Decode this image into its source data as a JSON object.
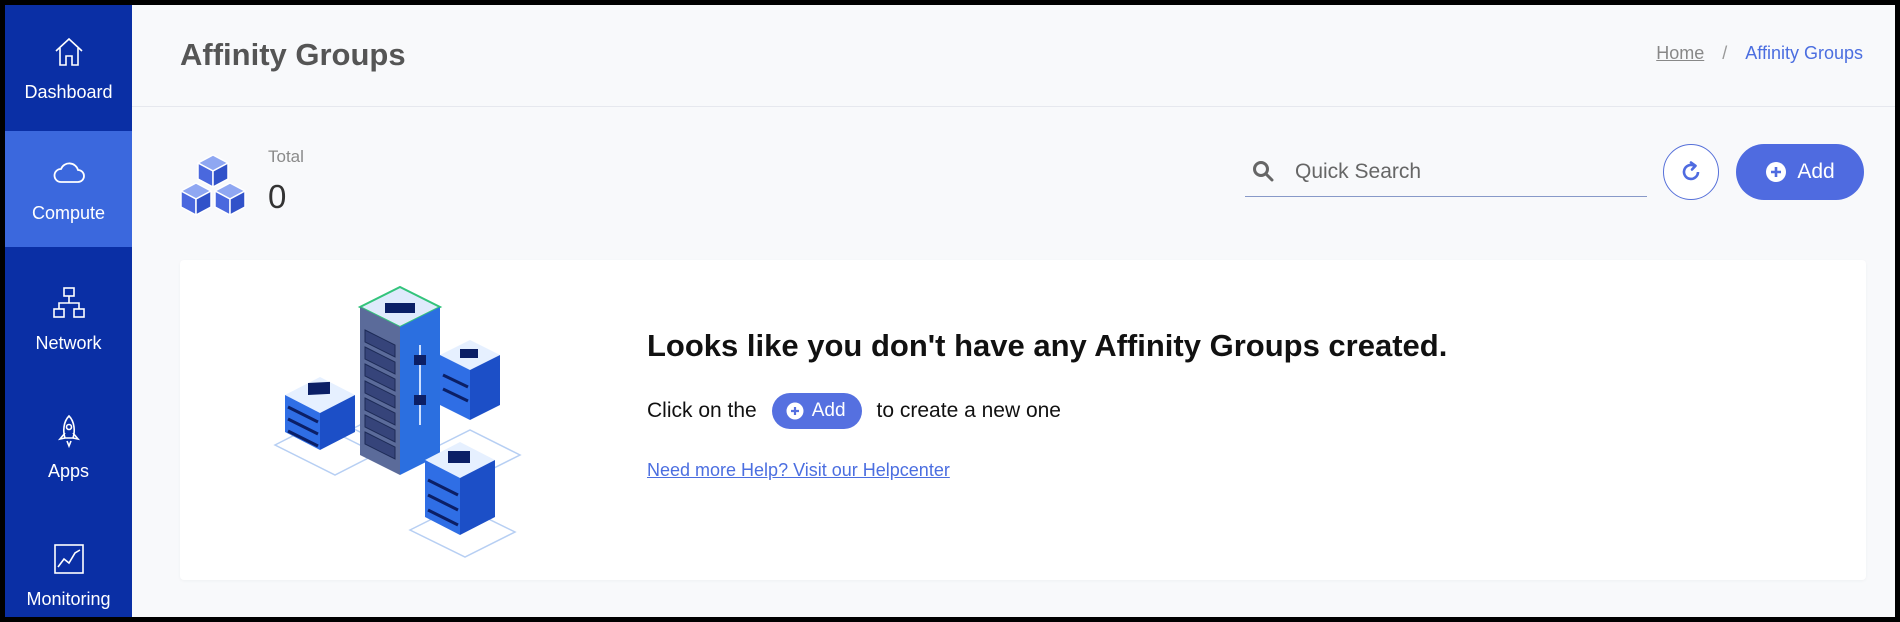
{
  "sidebar": {
    "items": [
      {
        "label": "Dashboard",
        "icon": "home-icon",
        "active": false
      },
      {
        "label": "Compute",
        "icon": "cloud-icon",
        "active": true
      },
      {
        "label": "Network",
        "icon": "network-icon",
        "active": false
      },
      {
        "label": "Apps",
        "icon": "rocket-icon",
        "active": false
      },
      {
        "label": "Monitoring",
        "icon": "chart-icon",
        "active": false
      }
    ]
  },
  "header": {
    "title": "Affinity Groups",
    "breadcrumb": {
      "home": "Home",
      "separator": "/",
      "current": "Affinity Groups"
    }
  },
  "summary": {
    "label": "Total",
    "value": "0",
    "icon": "cubes-icon"
  },
  "search": {
    "placeholder": "Quick Search",
    "value": ""
  },
  "toolbar": {
    "refresh_icon": "refresh-icon",
    "add_label": "Add"
  },
  "empty_state": {
    "title": "Looks like you don't have any Affinity Groups created.",
    "line_prefix": "Click on the",
    "button_label": "Add",
    "line_suffix": "to create a new one",
    "help_link": "Need more Help? Visit our Helpcenter"
  },
  "colors": {
    "sidebar": "#0a2fa5",
    "sidebar_active": "#3b68dd",
    "accent": "#4f6be0",
    "background": "#f8f9fb"
  }
}
